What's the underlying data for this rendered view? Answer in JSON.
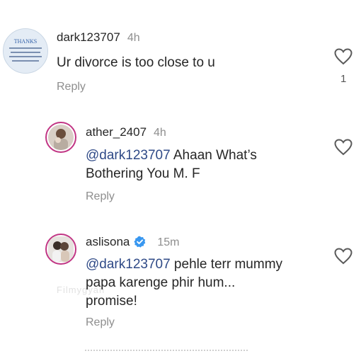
{
  "comments": [
    {
      "username": "dark123707",
      "time": "4h",
      "text": "Ur divorce is too close to u",
      "reply_label": "Reply",
      "like_count": "1",
      "avatar_text": "THANKS"
    },
    {
      "username": "ather_2407",
      "time": "4h",
      "mention": "@dark123707",
      "text_line1": " Ahaan What’s",
      "text_line2": "Bothering You M. F",
      "reply_label": "Reply"
    },
    {
      "username": "aslisona",
      "time": "15m",
      "verified": true,
      "mention": "@dark123707",
      "text_line1": " pehle terr mummy",
      "text_line2": "papa karenge phir hum...",
      "text_line3": "promise!",
      "reply_label": "Reply"
    }
  ],
  "watermark": "Filmygyan",
  "colors": {
    "text": "#262626",
    "muted": "#8e8e8e",
    "mention": "#2f4a87",
    "verified": "#3897f0"
  }
}
